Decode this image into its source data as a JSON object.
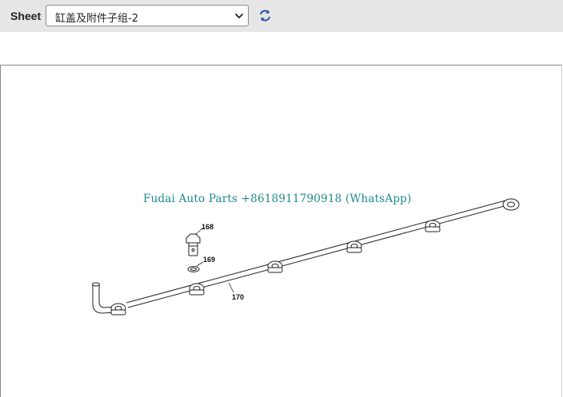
{
  "toolbar": {
    "sheet_label": "Sheet",
    "sheet_select": {
      "selected": "缸盖及附件子组-2"
    },
    "refresh_icon": "refresh-icon"
  },
  "diagram": {
    "watermark": "Fudai Auto Parts +8618911790918 (WhatsApp)",
    "callouts": {
      "part_168": "168",
      "part_169": "169",
      "part_170": "170"
    }
  }
}
